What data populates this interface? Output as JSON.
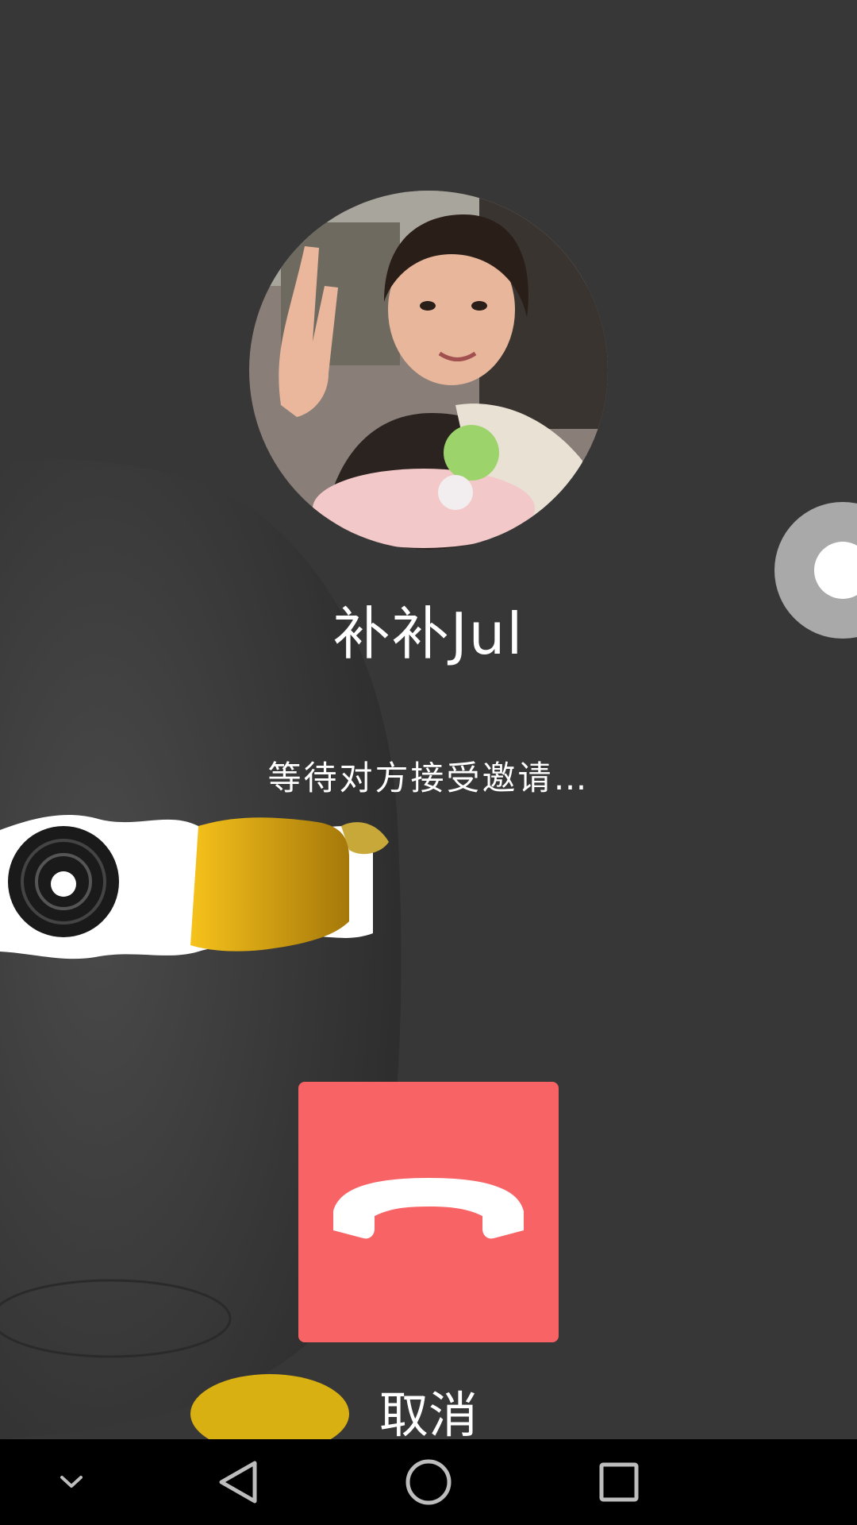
{
  "call": {
    "caller_name": "补补Jul",
    "status": "等待对方接受邀请…",
    "cancel_label": "取消"
  },
  "icons": {
    "hangup": "phone-hangup-icon",
    "floating": "floating-ball-icon",
    "nav_collapse": "chevron-down-icon",
    "nav_back": "triangle-back-icon",
    "nav_home": "circle-home-icon",
    "nav_recents": "square-recents-icon"
  },
  "colors": {
    "background": "#373737",
    "hangup_button": "#f86465",
    "navbar": "#000000",
    "text": "#ffffff"
  }
}
